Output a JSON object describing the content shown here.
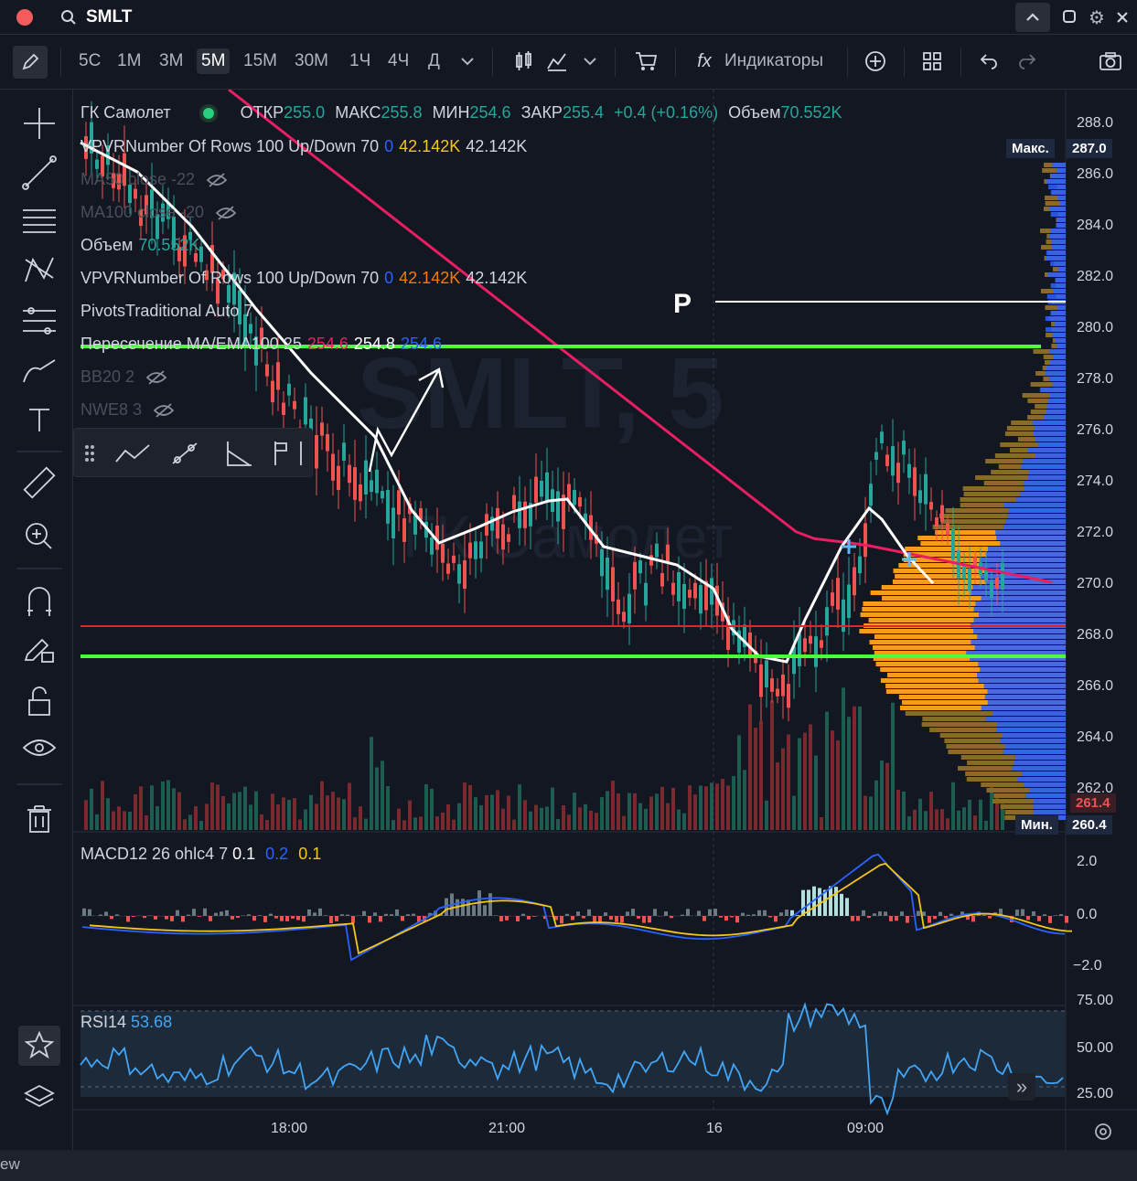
{
  "topbar": {
    "symbol": "SMLT"
  },
  "toolbar": {
    "timeframes": [
      "5С",
      "1М",
      "3М",
      "5М",
      "15М",
      "30М",
      "1Ч",
      "4Ч",
      "Д"
    ],
    "active_timeframe": "5М",
    "indicators_label": "Индикаторы"
  },
  "legend": {
    "name": "ГК Самолет",
    "open_label": "ОТКР",
    "open": "255.0",
    "high_label": "МАКС",
    "high": "255.8",
    "low_label": "МИН",
    "low": "254.6",
    "close_label": "ЗАКР",
    "close": "255.4",
    "change": "+0.4 (+0.16%)",
    "volume_label": "Объем",
    "volume": "70.552K",
    "indicators": [
      {
        "name": "VPVRNumber Of Rows 100 Up/Down 70",
        "v1": "0",
        "v2": "42.142K",
        "v3": "42.142K"
      },
      {
        "name": "MA50 close -22"
      },
      {
        "name": "MA100 close -20"
      },
      {
        "name": "Объем",
        "v1": "70.552K"
      },
      {
        "name": "VPVRNumber Of Rows 100 Up/Down 70",
        "v1": "0",
        "v2": "42.142K",
        "v3": "42.142K"
      },
      {
        "name": "PivotsTraditional Auto 7"
      },
      {
        "name": "Пересечение MA/EMA100 25",
        "v1": "254.6",
        "v2": "254.8",
        "v3": "254.6"
      },
      {
        "name": "BB20 2"
      },
      {
        "name": "NWE8 3"
      }
    ]
  },
  "watermark": {
    "line1": "SMLT, 5",
    "line2": "ГК Самолет"
  },
  "annotation": {
    "pivot_label": "P"
  },
  "price_axis": {
    "ticks": [
      "288.0",
      "286.0",
      "284.0",
      "282.0",
      "280.0",
      "278.0",
      "276.0",
      "274.0",
      "272.0",
      "270.0",
      "268.0",
      "266.0",
      "264.0",
      "262.0"
    ],
    "max_label": "Макс.",
    "max_value": "287.0",
    "min_label": "Мин.",
    "min_value": "260.4",
    "current_value": "261.4"
  },
  "time_axis": {
    "labels": [
      "18:00",
      "21:00",
      "16",
      "09:00"
    ]
  },
  "macd": {
    "title": "MACD12 26 ohlc4 7",
    "v1": "0.1",
    "v2": "0.2",
    "v3": "0.1",
    "ticks": [
      "2.0",
      "0.0",
      "−2.0"
    ]
  },
  "rsi": {
    "title": "RSI14",
    "value": "53.68",
    "ticks": [
      "75.00",
      "50.00",
      "25.00"
    ]
  },
  "bottombar": {
    "text": "ew"
  },
  "colors": {
    "bg": "#131722",
    "up": "#26a69a",
    "down": "#ef5350",
    "ma": "#e91e63",
    "pivot": "#4caf50",
    "macd_line": "#2962ff",
    "signal_line": "#f5c518",
    "rsi": "#42a5f5"
  }
}
